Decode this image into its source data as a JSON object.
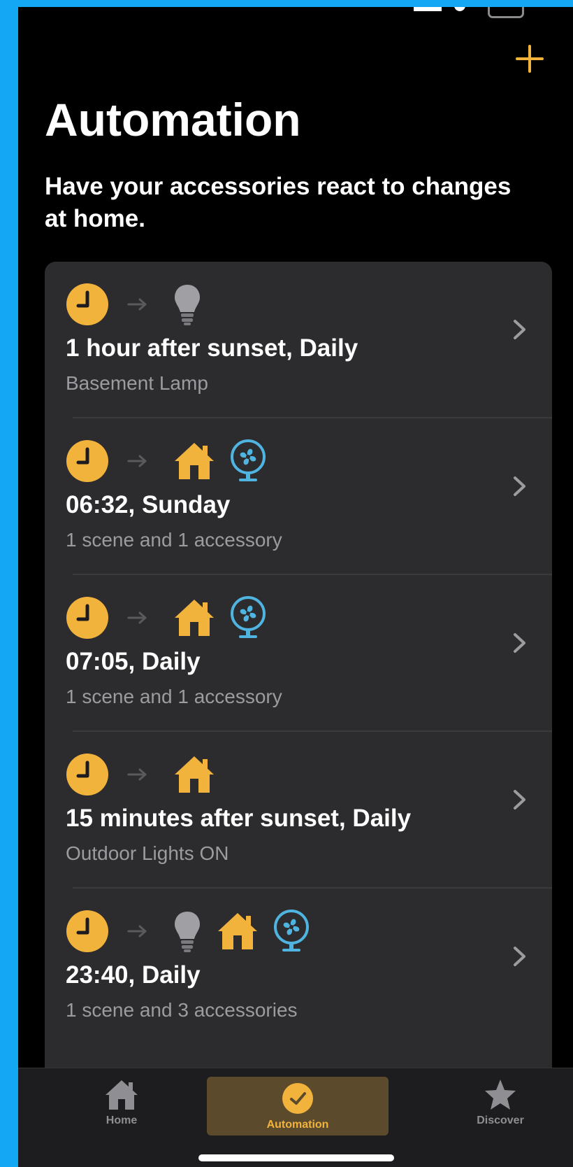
{
  "header": {
    "add_label": "+",
    "title": "Automation",
    "subtitle": "Have your accessories react to changes at home."
  },
  "automations": [
    {
      "title": "1 hour after sunset, Daily",
      "detail": "Basement Lamp",
      "icons": [
        "clock-icon",
        "arrow-right-icon",
        "lightbulb-icon"
      ]
    },
    {
      "title": "06:32, Sunday",
      "detail": "1 scene and 1 accessory",
      "icons": [
        "clock-icon",
        "arrow-right-icon",
        "home-scene-icon",
        "fan-icon"
      ]
    },
    {
      "title": "07:05, Daily",
      "detail": "1 scene and 1 accessory",
      "icons": [
        "clock-icon",
        "arrow-right-icon",
        "home-scene-icon",
        "fan-icon"
      ]
    },
    {
      "title": "15 minutes after sunset, Daily",
      "detail": "Outdoor Lights ON",
      "icons": [
        "clock-icon",
        "arrow-right-icon",
        "home-scene-icon"
      ]
    },
    {
      "title": "23:40, Daily",
      "detail": "1 scene and 3 accessories",
      "icons": [
        "clock-icon",
        "arrow-right-icon",
        "lightbulb-icon",
        "home-scene-icon",
        "fan-icon"
      ]
    }
  ],
  "tabbar": {
    "home": "Home",
    "automation": "Automation",
    "discover": "Discover",
    "selected": "Automation"
  },
  "colors": {
    "accent": "#f2b33d",
    "fan": "#4fb4e0",
    "card": "#2c2c2e",
    "frame": "#14a7f3"
  }
}
